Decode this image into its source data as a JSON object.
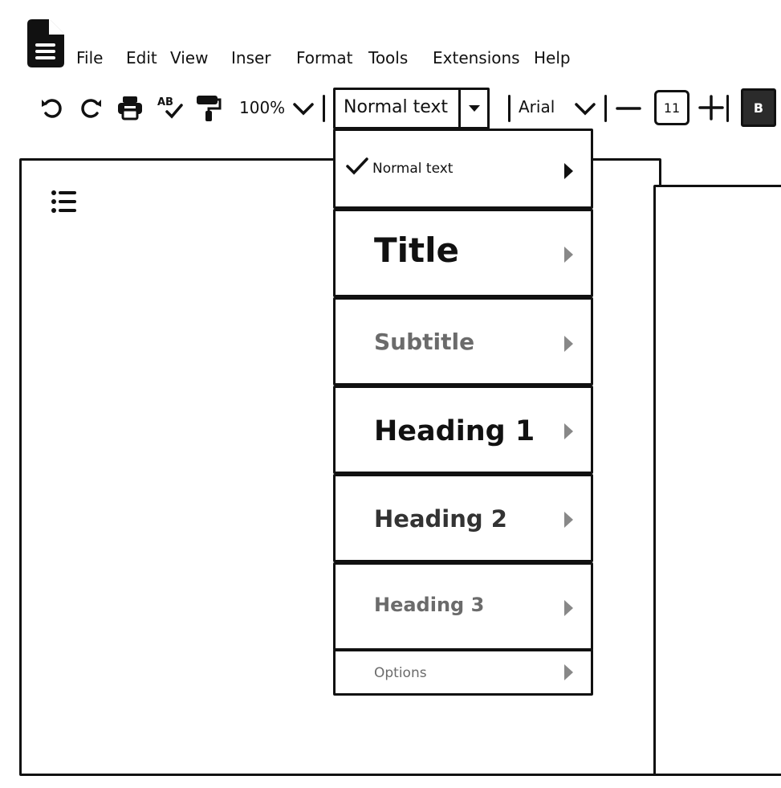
{
  "menu": {
    "items": [
      "File",
      "Edit",
      "View",
      "Inser",
      "Format",
      "Tools",
      "Extensions",
      "Help"
    ]
  },
  "toolbar": {
    "icons": [
      "undo-icon",
      "redo-icon",
      "print-icon",
      "spellcheck-icon",
      "paint-format-icon"
    ],
    "spellcheck_glyph": "AB",
    "zoom": "100%",
    "style_value": "Normal text",
    "font_value": "Arial",
    "font_size": "11",
    "bold_label": "B"
  },
  "dropdown": {
    "items": [
      {
        "label": "Normal text",
        "selected": true
      },
      {
        "label": "Title"
      },
      {
        "label": "Subtitle"
      },
      {
        "label": "Heading 1"
      },
      {
        "label": "Heading 2"
      },
      {
        "label": "Heading 3"
      },
      {
        "label": "Options"
      }
    ]
  },
  "colors": {
    "ink": "#111111",
    "muted": "#6b6b6b",
    "bold_button_bg": "#2b2b2b",
    "arrow_gray": "#888888"
  }
}
